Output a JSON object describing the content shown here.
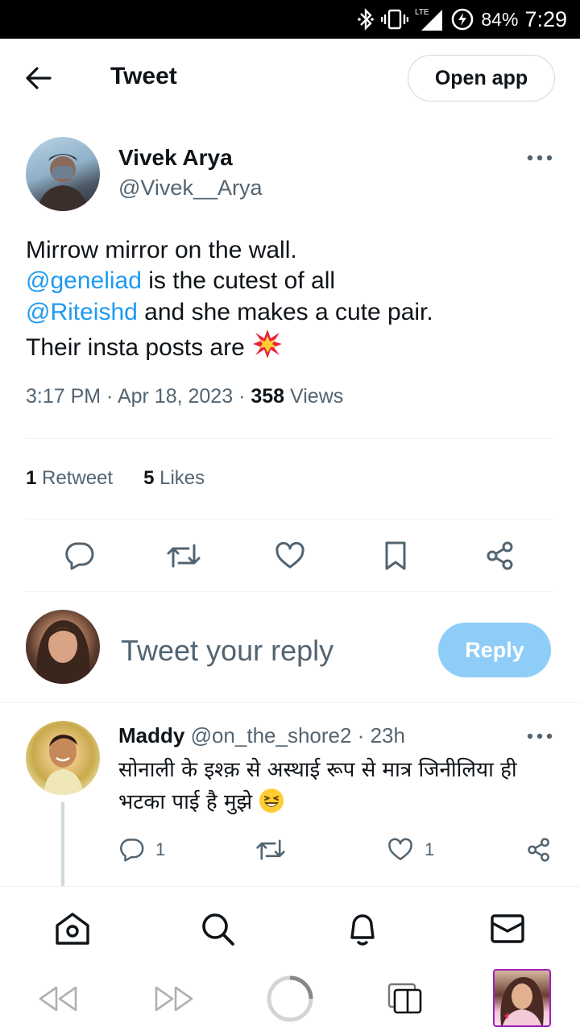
{
  "status_bar": {
    "battery": "84%",
    "time": "7:29",
    "network": "LTE"
  },
  "header": {
    "title": "Tweet",
    "open_app": "Open app"
  },
  "tweet": {
    "author_name": "Vivek Arya",
    "author_handle": "@Vivek__Arya",
    "text": {
      "line1": "Mirrow mirror on the wall.",
      "mention1": "@geneliad",
      "line2_rest": " is the cutest of all",
      "mention2": "@Riteishd",
      "line3_rest": " and she makes a cute pair.",
      "line4": "Their insta posts are "
    },
    "time": "3:17 PM",
    "date": "Apr 18, 2023",
    "views_count": "358",
    "views_label": "Views",
    "retweets_count": "1",
    "retweets_label": "Retweet",
    "likes_count": "5",
    "likes_label": "Likes"
  },
  "composer": {
    "placeholder": "Tweet your reply",
    "reply_label": "Reply"
  },
  "reply": {
    "name": "Maddy",
    "handle": "@on_the_shore2",
    "age": "23h",
    "text": "सोनाली के इश्क़ से अस्थाई रूप से मात्र जिनीलिया ही भटका पाई है मुझे ",
    "reply_count": "1",
    "like_count": "1"
  },
  "colors": {
    "accent": "#1d9bf0",
    "reply_button": "#8ecdf7",
    "secondary_text": "#536471"
  },
  "icons": [
    "back-arrow-icon",
    "more-icon",
    "reply-icon",
    "retweet-icon",
    "like-icon",
    "bookmark-icon",
    "share-icon",
    "home-icon",
    "search-icon",
    "notifications-icon",
    "messages-icon"
  ]
}
